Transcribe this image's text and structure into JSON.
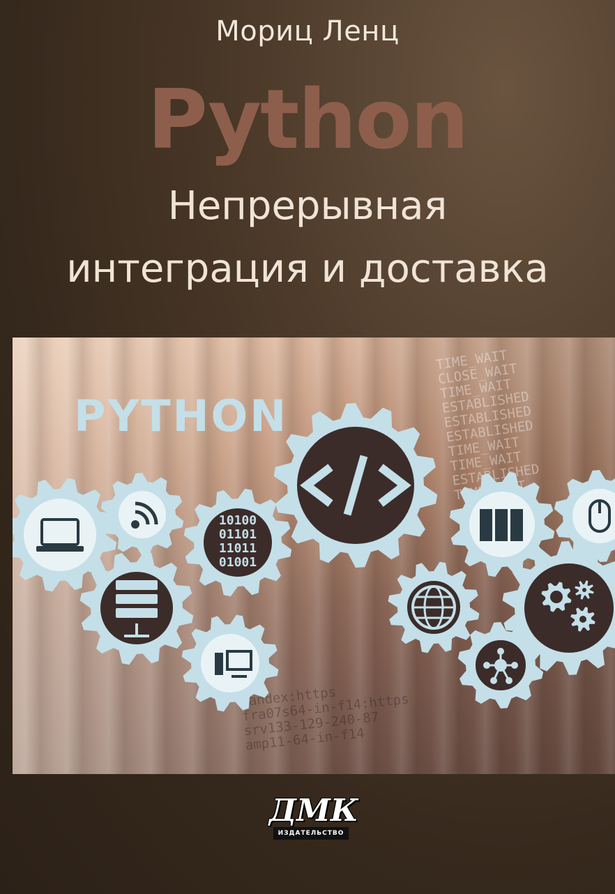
{
  "cover": {
    "author": "Мориц Ленц",
    "title": "Python",
    "subtitle_line1": "Непрерывная",
    "subtitle_line2": "интеграция и доставка"
  },
  "illustration": {
    "word": "PYTHON",
    "binary_lines": [
      "10100",
      "01101",
      "11011",
      "01001"
    ],
    "code_symbol": "</>",
    "background_text_right": "TIME_WAIT\nCLOSE_WAIT\nTIME_WAIT\nESTABLISHED\nESTABLISHED\nESTABLISHED\nTIME_WAIT\nTIME_WAIT\nESTABLISHED\nTIME_WAIT",
    "background_text_bottom": "yandex:https\nfra07s64-in-f14:https\nsrv133-129-240-87\namp11-64-in-f14",
    "icons": [
      "laptop-icon",
      "wifi-icon",
      "code-icon",
      "server-icon",
      "mouse-icon",
      "database-icon",
      "monitor-icon",
      "globe-icon",
      "gears-icon",
      "network-icon"
    ]
  },
  "publisher": {
    "logo_text": "ДМК",
    "strip_text": "ИЗДАТЕЛЬСТВО"
  },
  "colors": {
    "background": "#3a2b1f",
    "title": "#8d5e4c",
    "text": "#f0e4d7",
    "gear": "#c4dfe8"
  }
}
